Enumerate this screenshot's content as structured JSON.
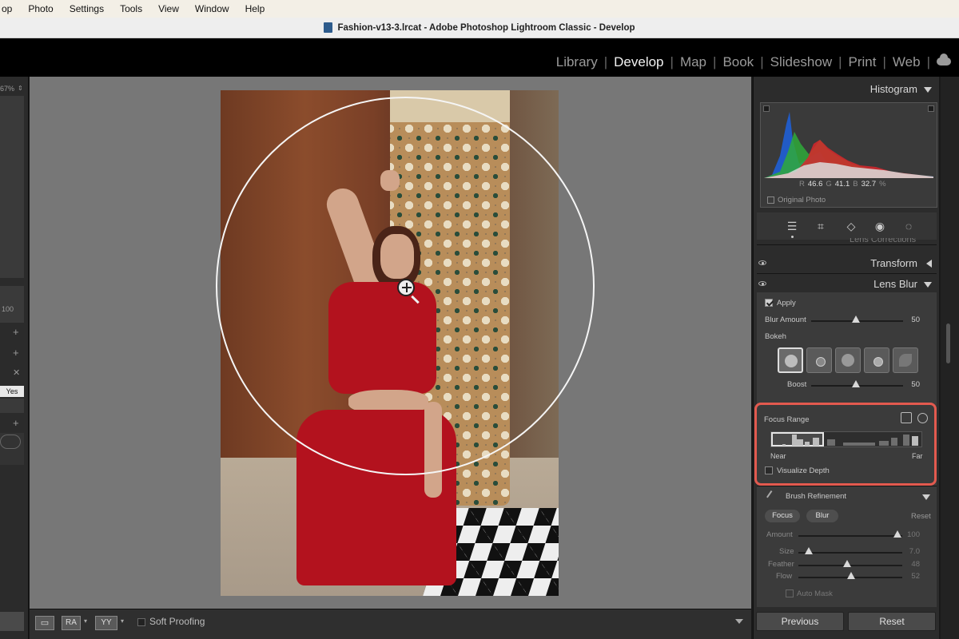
{
  "menubar": {
    "items": [
      "op",
      "Photo",
      "Settings",
      "Tools",
      "View",
      "Window",
      "Help"
    ]
  },
  "window": {
    "title": "Fashion-v13-3.lrcat - Adobe Photoshop Lightroom Classic - Develop"
  },
  "modules": [
    "Library",
    "Develop",
    "Map",
    "Book",
    "Slideshow",
    "Print",
    "Web"
  ],
  "active_module": "Develop",
  "left_panel": {
    "zoom": "67%",
    "value_100": "100",
    "yes_label": "Yes"
  },
  "toolbar": {
    "soft_proofing_label": "Soft Proofing",
    "view_a": "RA",
    "view_b": "YY"
  },
  "right_panel": {
    "histogram": {
      "title": "Histogram",
      "r_label": "R",
      "r_value": "46.6",
      "g_label": "G",
      "g_value": "41.1",
      "b_label": "B",
      "b_value": "32.7",
      "percent": "%",
      "original_photo_label": "Original Photo"
    },
    "lens_corrections_label": "Lens Corrections",
    "transform_label": "Transform",
    "lens_blur": {
      "title": "Lens Blur",
      "apply_label": "Apply",
      "apply_checked": true,
      "blur_amount_label": "Blur Amount",
      "blur_amount_value": "50",
      "bokeh_label": "Bokeh",
      "boost_label": "Boost",
      "boost_value": "50",
      "focus_range_label": "Focus Range",
      "near_label": "Near",
      "far_label": "Far",
      "visualize_depth_label": "Visualize Depth",
      "brush_refinement_label": "Brush Refinement",
      "focus_btn": "Focus",
      "blur_btn": "Blur",
      "reset_label": "Reset",
      "amount_label": "Amount",
      "amount_value": "100",
      "size_label": "Size",
      "size_value": "7.0",
      "feather_label": "Feather",
      "feather_value": "48",
      "flow_label": "Flow",
      "flow_value": "52",
      "auto_mask_label": "Auto Mask"
    },
    "previous_label": "Previous",
    "reset_label": "Reset"
  },
  "colors": {
    "highlight": "#e35a4f",
    "panel": "#2c2c2c",
    "canvas": "#777777"
  }
}
